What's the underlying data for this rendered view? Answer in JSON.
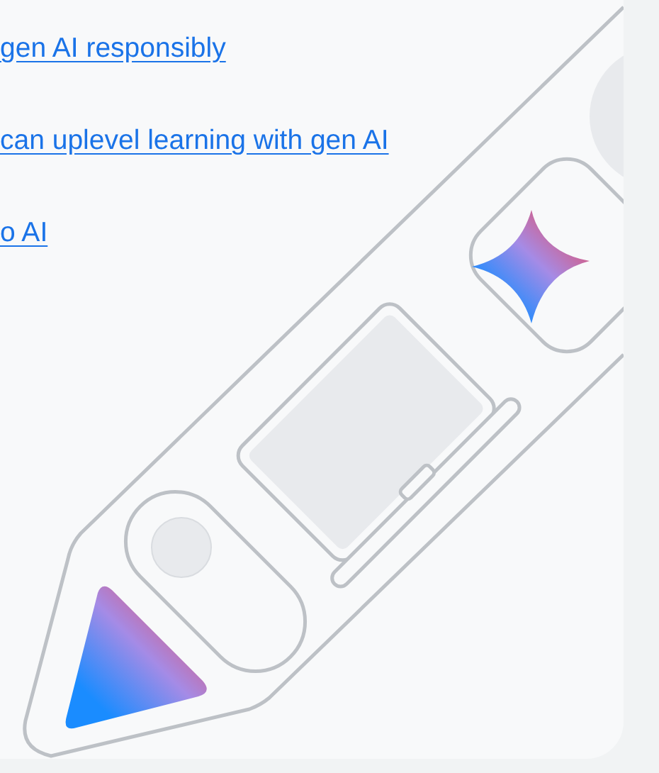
{
  "links": [
    {
      "text": "gen AI responsibly"
    },
    {
      "text": "can uplevel learning with gen AI"
    },
    {
      "text": "o AI"
    }
  ]
}
